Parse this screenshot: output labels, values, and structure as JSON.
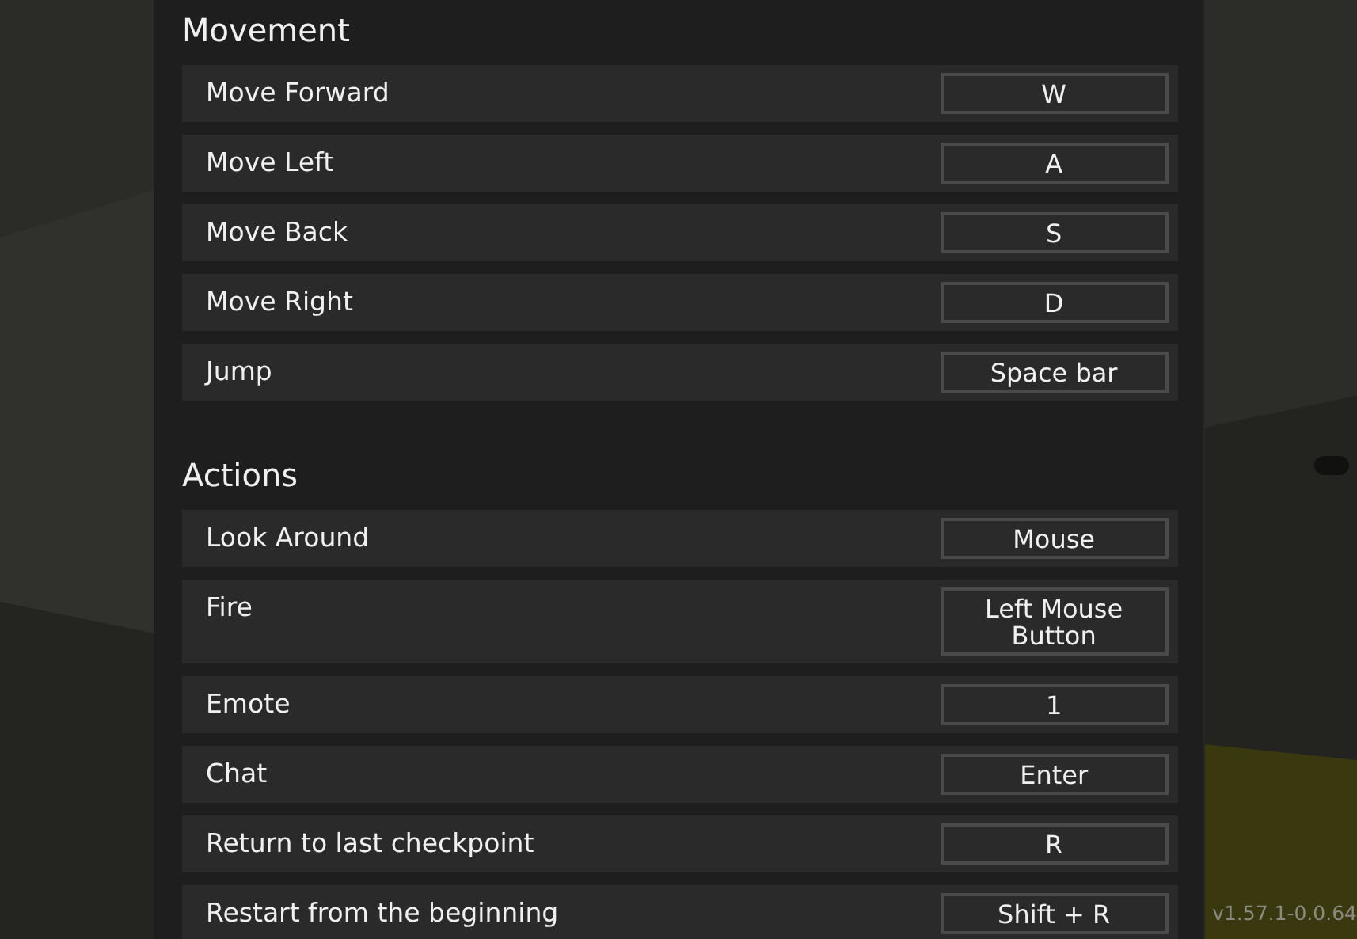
{
  "sections": [
    {
      "title": "Movement",
      "bindings": [
        {
          "action": "Move Forward",
          "key": "W"
        },
        {
          "action": "Move Left",
          "key": "A"
        },
        {
          "action": "Move Back",
          "key": "S"
        },
        {
          "action": "Move Right",
          "key": "D"
        },
        {
          "action": "Jump",
          "key": "Space bar"
        }
      ]
    },
    {
      "title": "Actions",
      "bindings": [
        {
          "action": "Look Around",
          "key": "Mouse"
        },
        {
          "action": "Fire",
          "key": "Left Mouse Button"
        },
        {
          "action": "Emote",
          "key": "1"
        },
        {
          "action": "Chat",
          "key": "Enter"
        },
        {
          "action": "Return to last checkpoint",
          "key": "R"
        },
        {
          "action": "Restart from the beginning",
          "key": "Shift + R"
        }
      ]
    }
  ],
  "version": "v1.57.1-0.0.64"
}
